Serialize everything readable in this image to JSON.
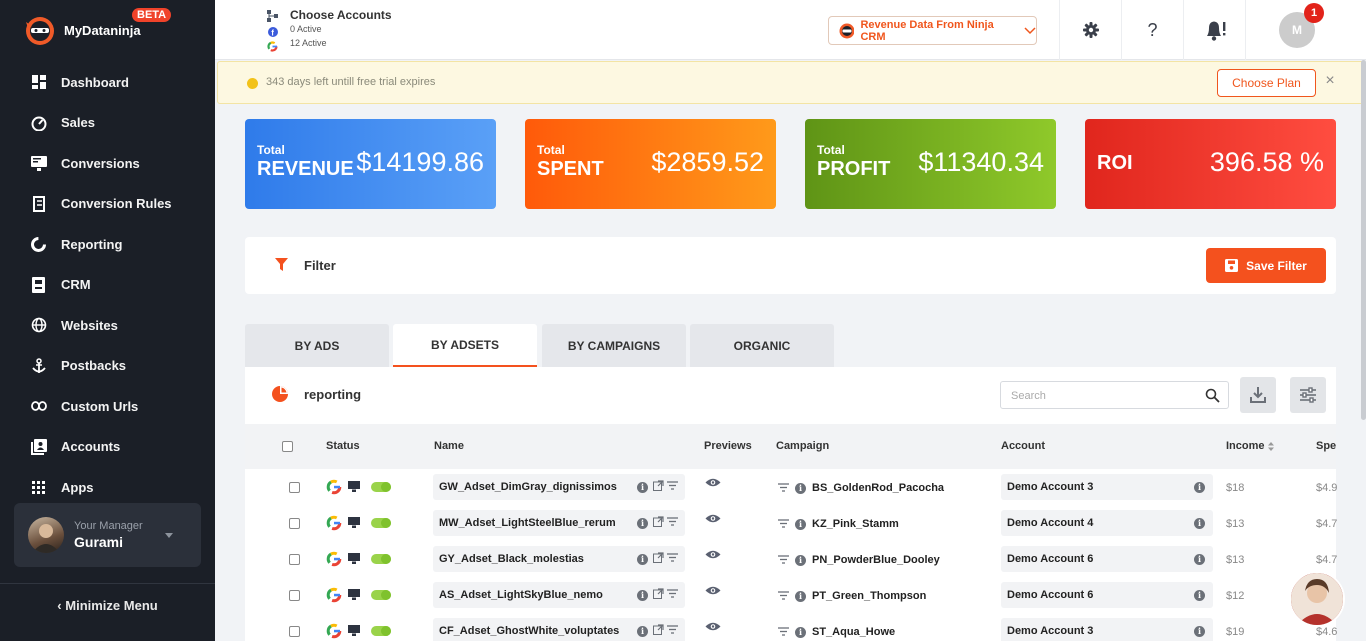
{
  "brand": {
    "name": "MyDataninja",
    "badge": "BETA"
  },
  "sidebar": {
    "items": [
      {
        "label": "Dashboard",
        "icon": "dashboard-icon"
      },
      {
        "label": "Sales",
        "icon": "speedometer-icon"
      },
      {
        "label": "Conversions",
        "icon": "monitor-icon"
      },
      {
        "label": "Conversion Rules",
        "icon": "rules-icon"
      },
      {
        "label": "Reporting",
        "icon": "reporting-icon"
      },
      {
        "label": "CRM",
        "icon": "crm-icon"
      },
      {
        "label": "Websites",
        "icon": "globe-icon"
      },
      {
        "label": "Postbacks",
        "icon": "anchor-icon"
      },
      {
        "label": "Custom Urls",
        "icon": "link-icon"
      },
      {
        "label": "Accounts",
        "icon": "accounts-icon"
      },
      {
        "label": "Apps",
        "icon": "apps-grid-icon"
      }
    ],
    "manager": {
      "caption": "Your Manager",
      "name": "Gurami"
    },
    "minimize": "Minimize Menu"
  },
  "header": {
    "accounts_title": "Choose Accounts",
    "facebook_active": "0 Active",
    "google_active": "12 Active",
    "crm_button": "Revenue Data From Ninja CRM",
    "help": "?",
    "user_initial": "M",
    "notification_count": "1"
  },
  "trial": {
    "message": "343 days left untill free trial expires",
    "cta": "Choose Plan",
    "close": "×"
  },
  "kpis": {
    "revenue": {
      "small": "Total",
      "big": "REVENUE",
      "value": "$14199.86"
    },
    "spent": {
      "small": "Total",
      "big": "SPENT",
      "value": "$2859.52"
    },
    "profit": {
      "small": "Total",
      "big": "PROFIT",
      "value": "$11340.34"
    },
    "roi": {
      "big": "ROI",
      "value": "396.58 %"
    }
  },
  "filter": {
    "label": "Filter",
    "save": "Save Filter"
  },
  "tabs": [
    "BY ADS",
    "BY ADSETS",
    "BY CAMPAIGNS",
    "ORGANIC"
  ],
  "active_tab": "BY ADSETS",
  "report": {
    "title": "reporting",
    "search_placeholder": "Search",
    "columns": {
      "status": "Status",
      "name": "Name",
      "previews": "Previews",
      "campaign": "Campaign",
      "account": "Account",
      "income": "Income",
      "spent": "Spe"
    },
    "rows": [
      {
        "name": "GW_Adset_DimGray_dignissimos",
        "campaign": "BS_GoldenRod_Pacocha",
        "account": "Demo Account 3",
        "income": "$18",
        "spent": "$4.9"
      },
      {
        "name": "MW_Adset_LightSteelBlue_rerum",
        "campaign": "KZ_Pink_Stamm",
        "account": "Demo Account 4",
        "income": "$13",
        "spent": "$4.7"
      },
      {
        "name": "GY_Adset_Black_molestias",
        "campaign": "PN_PowderBlue_Dooley",
        "account": "Demo Account 6",
        "income": "$13",
        "spent": "$4.7"
      },
      {
        "name": "AS_Adset_LightSkyBlue_nemo",
        "campaign": "PT_Green_Thompson",
        "account": "Demo Account 6",
        "income": "$12",
        "spent": "$4.6"
      },
      {
        "name": "CF_Adset_GhostWhite_voluptates",
        "campaign": "ST_Aqua_Howe",
        "account": "Demo Account 3",
        "income": "$19",
        "spent": "$4.6"
      }
    ]
  },
  "colors": {
    "accent": "#f4511e",
    "sidebar": "#1b1f27",
    "revenue": "#3b82f6",
    "spent": "#ff7a00",
    "profit": "#7cb518",
    "roi": "#ee3a2e"
  }
}
